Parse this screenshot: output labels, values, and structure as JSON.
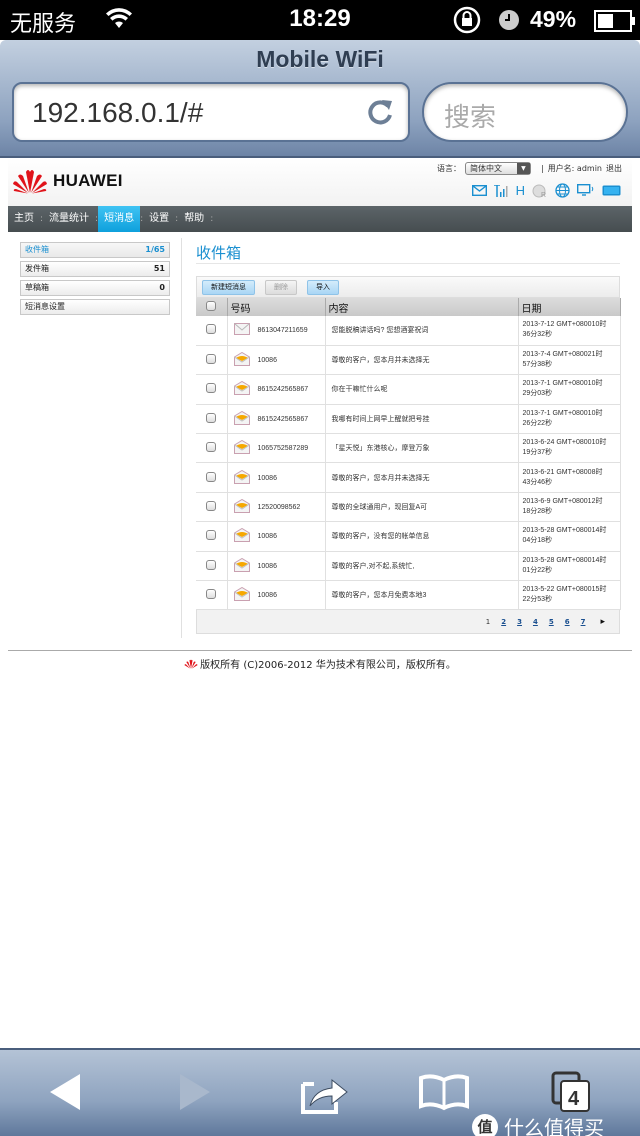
{
  "status_bar": {
    "carrier": "无服务",
    "time": "18:29",
    "battery_percent": "49%",
    "battery_level": 0.49
  },
  "browser": {
    "title": "Mobile WiFi",
    "url": "192.168.0.1/#",
    "search_placeholder": "搜索",
    "tab_count": "4"
  },
  "header": {
    "logo_text": "HUAWEI",
    "language_label": "语言：",
    "language_value": "简体中文",
    "user_label": "用户名: admin",
    "logout": "退出",
    "separator": "|",
    "status_icons": [
      "sms-envelope-icon",
      "signal-strength-icon",
      "network-type-h-icon",
      "roaming-globe-icon",
      "internet-globe-icon",
      "wifi-device-icon",
      "battery-icon"
    ],
    "network_type": "H",
    "accent_color": "#1a8fd0"
  },
  "nav": {
    "items": [
      {
        "label": "主页",
        "active": false
      },
      {
        "label": "流量统计",
        "active": false
      },
      {
        "label": "短消息",
        "active": true
      },
      {
        "label": "设置",
        "active": false
      },
      {
        "label": "帮助",
        "active": false
      }
    ],
    "separator": ":"
  },
  "sidebar": {
    "items": [
      {
        "label": "收件箱",
        "count": "1/65",
        "active": true
      },
      {
        "label": "发件箱",
        "count": "51",
        "active": false
      },
      {
        "label": "草稿箱",
        "count": "0",
        "active": false
      },
      {
        "label": "短消息设置",
        "count": "",
        "active": false
      }
    ]
  },
  "main": {
    "title": "收件箱",
    "buttons": {
      "new": "新建短消息",
      "delete": "删除",
      "import": "导入"
    },
    "columns": [
      "号码",
      "内容",
      "日期"
    ],
    "messages": [
      {
        "read": true,
        "number": "8613047211659",
        "content": "您能脱稿讲话吗? 您想酒宴祝词",
        "date_line1": "2013-7-12 GMT+080010时",
        "date_line2": "36分32秒"
      },
      {
        "read": false,
        "number": "10086",
        "content": "尊敬的客户，您本月并未选择无",
        "date_line1": "2013-7-4 GMT+080021时",
        "date_line2": "57分38秒"
      },
      {
        "read": false,
        "number": "8615242565867",
        "content": "你在干嘛忙什么呢",
        "date_line1": "2013-7-1 GMT+080010时",
        "date_line2": "29分03秒"
      },
      {
        "read": false,
        "number": "8615242565867",
        "content": "我哪有时间上网早上醒就把号挂",
        "date_line1": "2013-7-1 GMT+080010时",
        "date_line2": "26分22秒"
      },
      {
        "read": false,
        "number": "1065752587289",
        "content": "「星天悦」东港核心，摩登万象",
        "date_line1": "2013-6-24 GMT+080010时",
        "date_line2": "19分37秒"
      },
      {
        "read": false,
        "number": "10086",
        "content": "尊敬的客户，您本月并未选择无",
        "date_line1": "2013-6-21 GMT+08008时",
        "date_line2": "43分46秒"
      },
      {
        "read": false,
        "number": "12520098562",
        "content": "尊敬的全球通用户，现回复A可",
        "date_line1": "2013-6-9 GMT+080012时",
        "date_line2": "18分28秒"
      },
      {
        "read": false,
        "number": "10086",
        "content": "尊敬的客户，没有您的帐单信息",
        "date_line1": "2013-5-28 GMT+080014时",
        "date_line2": "04分18秒"
      },
      {
        "read": false,
        "number": "10086",
        "content": "尊敬的客户,对不起,系统忙,",
        "date_line1": "2013-5-28 GMT+080014时",
        "date_line2": "01分22秒"
      },
      {
        "read": false,
        "number": "10086",
        "content": "尊敬的客户，您本月免费本地3",
        "date_line1": "2013-5-22 GMT+080015时",
        "date_line2": "22分53秒"
      }
    ],
    "pagination": {
      "current": "1",
      "pages": [
        "2",
        "3",
        "4",
        "5",
        "6",
        "7"
      ],
      "next": "▸"
    }
  },
  "footer": {
    "text": "版权所有 (C)2006-2012 华为技术有限公司，版权所有。"
  },
  "watermark": {
    "badge": "值",
    "text": "什么值得买"
  }
}
